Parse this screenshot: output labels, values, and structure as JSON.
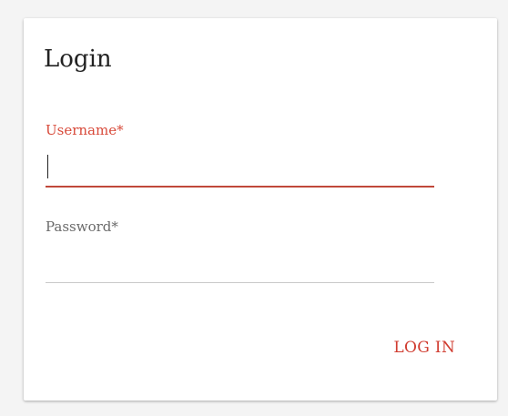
{
  "login": {
    "title": "Login",
    "username": {
      "label": "Username*",
      "value": "",
      "placeholder": ""
    },
    "password": {
      "label": "Password*",
      "value": "",
      "placeholder": ""
    },
    "submit_label": "LOG IN"
  },
  "colors": {
    "accent": "#d03c30",
    "label_muted": "#6a6a6a",
    "divider": "#c9c9c9",
    "background": "#f4f4f4",
    "card": "#ffffff"
  }
}
